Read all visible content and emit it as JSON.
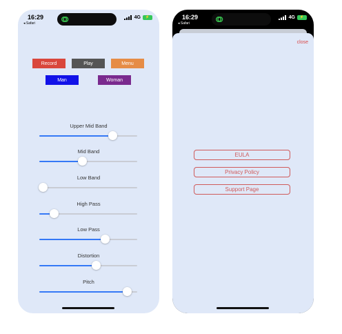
{
  "status_bar": {
    "time": "16:29",
    "back_label": "◂ Safari",
    "network": "4G"
  },
  "left": {
    "buttons": {
      "record": "Record",
      "play": "Play",
      "menu": "Menu",
      "man": "Man",
      "woman": "Woman"
    },
    "sliders": [
      {
        "label": "Upper Mid Band",
        "value": 0.75
      },
      {
        "label": "Mid Band",
        "value": 0.44
      },
      {
        "label": "Low Band",
        "value": 0.04
      },
      {
        "label": "High Pass",
        "value": 0.15
      },
      {
        "label": "Low Pass",
        "value": 0.67
      },
      {
        "label": "Distortion",
        "value": 0.58
      },
      {
        "label": "Pitch",
        "value": 0.9
      }
    ]
  },
  "right": {
    "close_label": "close",
    "links": [
      "EULA",
      "Privacy Policy",
      "Support Page"
    ]
  },
  "colors": {
    "accent": "#3478f6",
    "record": "#d9473c",
    "play": "#555555",
    "menu": "#e68c46",
    "man": "#1212e8",
    "woman": "#7a2a8e",
    "link": "#cf5a5a"
  }
}
